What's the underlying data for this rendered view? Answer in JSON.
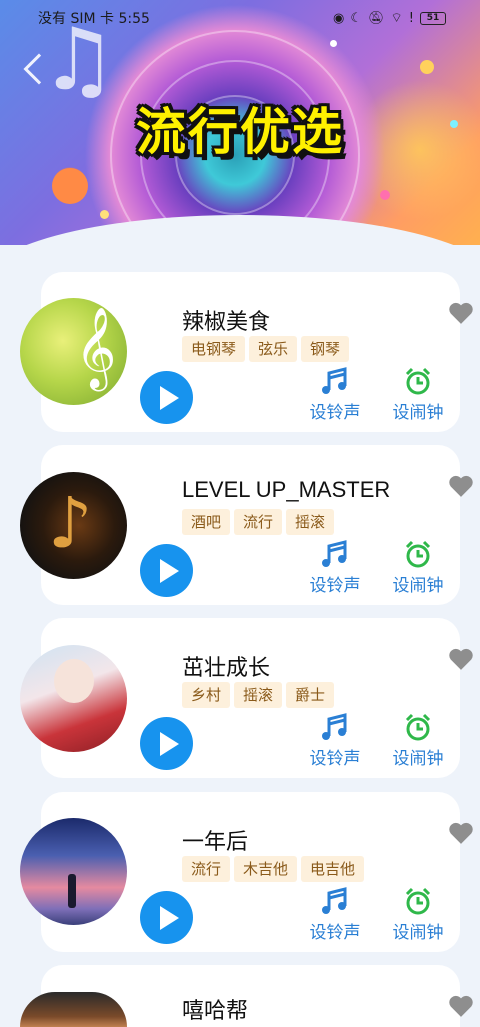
{
  "status_bar": {
    "carrier": "没有 SIM 卡",
    "time": "5:55",
    "battery": "51"
  },
  "header": {
    "title": "流行优选"
  },
  "actions": {
    "ringtone_label": "设铃声",
    "alarm_label": "设闹钟"
  },
  "colors": {
    "play": "#1793ee",
    "tag_bg": "#fdf0dc",
    "ring_icon": "#2a7fd4",
    "alarm_icon": "#2fb84a",
    "heart": "#8e8e8e"
  },
  "songs": [
    {
      "name": "辣椒美食",
      "tags": [
        "电钢琴",
        "弦乐",
        "钢琴"
      ]
    },
    {
      "name": "LEVEL UP_MASTER",
      "tags": [
        "酒吧",
        "流行",
        "摇滚"
      ]
    },
    {
      "name": "茁壮成长",
      "tags": [
        "乡村",
        "摇滚",
        "爵士"
      ]
    },
    {
      "name": "一年后",
      "tags": [
        "流行",
        "木吉他",
        "电吉他"
      ]
    },
    {
      "name": "嘻哈帮",
      "tags": []
    }
  ]
}
